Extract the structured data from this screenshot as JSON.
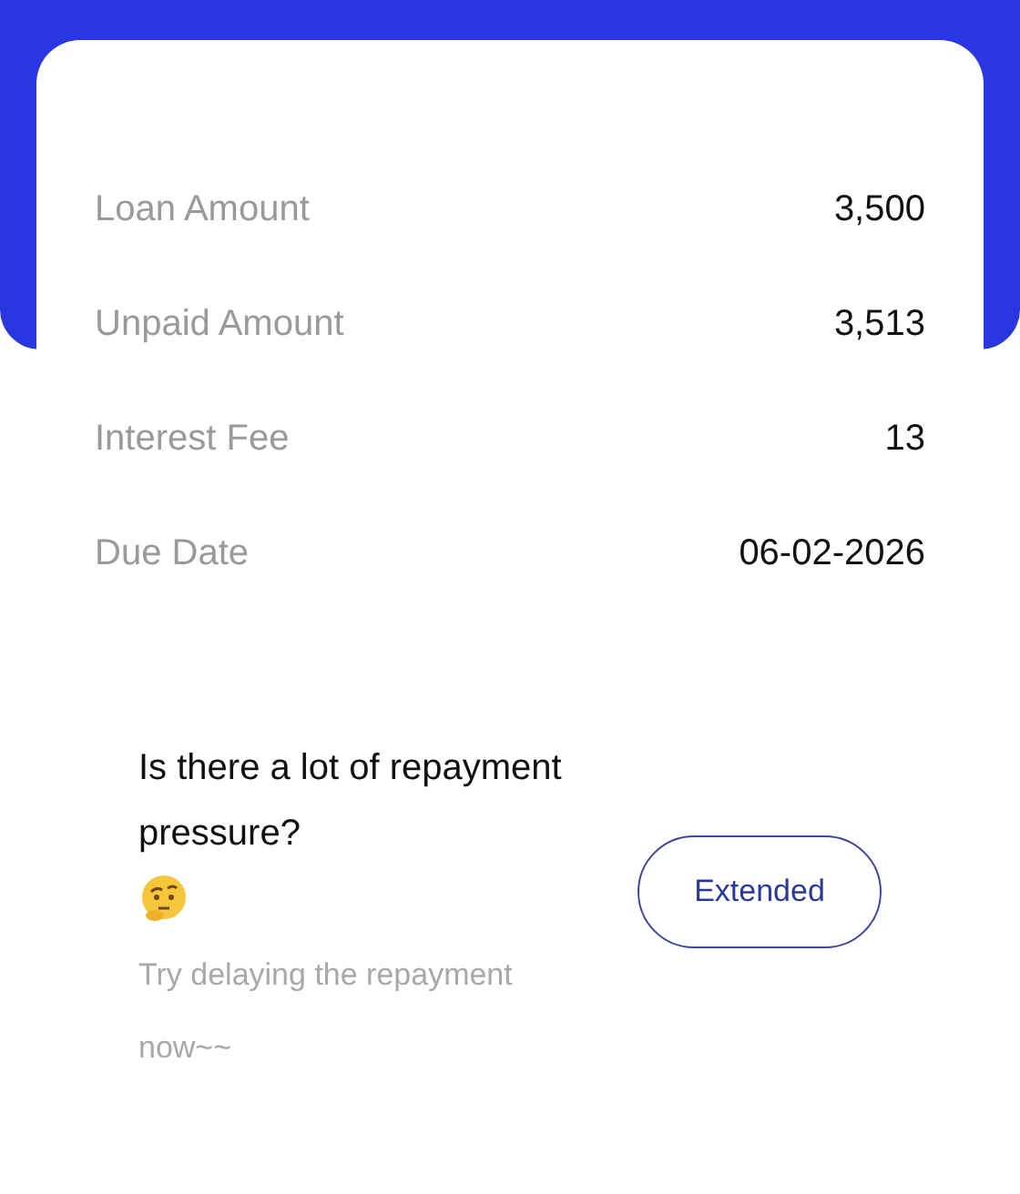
{
  "details": [
    {
      "label": "Loan Amount",
      "value": "3,500"
    },
    {
      "label": "Unpaid Amount",
      "value": "3,513"
    },
    {
      "label": "Interest Fee",
      "value": "13"
    },
    {
      "label": "Due Date",
      "value": "06-02-2026"
    }
  ],
  "prompt": {
    "question": "Is there a lot of repayment pressure?",
    "hint": "Try delaying the repayment now~~",
    "button": "Extended"
  }
}
